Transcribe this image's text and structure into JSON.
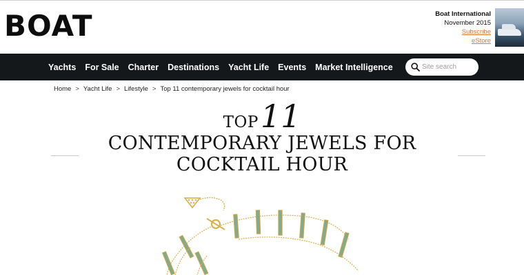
{
  "header": {
    "logo": "BOAT",
    "magazine": {
      "name": "Boat International",
      "issue": "November 2015",
      "subscribe": "Subscribe",
      "estore": "eStore"
    }
  },
  "nav": {
    "items": [
      "Yachts",
      "For Sale",
      "Charter",
      "Destinations",
      "Yacht Life",
      "Events",
      "Market Intelligence"
    ],
    "search_placeholder": "Site search"
  },
  "breadcrumb": [
    "Home",
    "Yacht Life",
    "Lifestyle",
    "Top 11 contemporary jewels for cocktail hour"
  ],
  "breadcrumb_separator": ">",
  "article": {
    "title_top": "TOP",
    "title_number": "11",
    "title_line1": "CONTEMPORARY JEWELS FOR",
    "title_line2": "COCKTAIL HOUR"
  },
  "colors": {
    "nav_background": "#15181a",
    "link_accent": "#e0783a",
    "gold": "#d9b24a",
    "gem_green": "#6f9c86"
  },
  "icons": [
    "search-icon",
    "magazine-cover-thumbnail"
  ]
}
